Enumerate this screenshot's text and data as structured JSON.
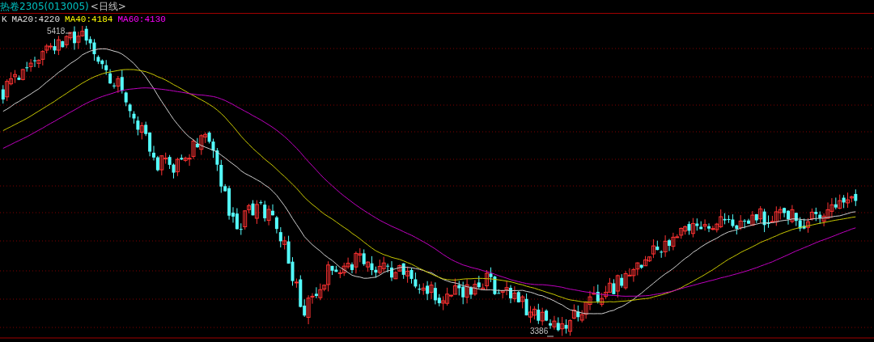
{
  "header": {
    "title": "热卷2305(013005)",
    "period": "<日线>"
  },
  "legend": [
    {
      "label": "K"
    },
    {
      "label": "MA20:4220",
      "color": "#e0e0e0"
    },
    {
      "label": "MA40:4184",
      "color": "#ffff00"
    },
    {
      "label": "MA60:4130",
      "color": "#ff00ff"
    }
  ],
  "chart": {
    "high_label": "5418",
    "low_label": "3386"
  }
}
